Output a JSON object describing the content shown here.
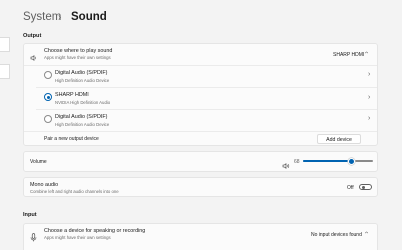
{
  "header": {
    "parent": "System",
    "current": "Sound"
  },
  "output": {
    "section_label": "Output",
    "choose": {
      "title": "Choose where to play sound",
      "subtitle": "Apps might have their own settings",
      "value": "SHARP HDMI"
    },
    "devices": [
      {
        "title": "Digital Audio (S/PDIF)",
        "subtitle": "High Definition Audio Device",
        "selected": false
      },
      {
        "title": "SHARP HDMI",
        "subtitle": "NVIDIA High Definition Audio",
        "selected": true
      },
      {
        "title": "Digital Audio (S/PDIF)",
        "subtitle": "High Definition Audio Device",
        "selected": false
      }
    ],
    "pair": {
      "label": "Pair a new output device",
      "button": "Add device"
    },
    "volume": {
      "label": "Volume",
      "value": "68",
      "level": 0.68
    },
    "mono": {
      "title": "Mono audio",
      "subtitle": "Combine left and right audio channels into one",
      "state": "Off"
    }
  },
  "input": {
    "section_label": "Input",
    "choose": {
      "title": "Choose a device for speaking or recording",
      "subtitle": "Apps might have their own settings",
      "value": "No input devices found"
    }
  },
  "icons": {
    "speaker": "speaker-icon",
    "mic": "microphone-icon",
    "chevron": "chevron-right-icon"
  },
  "colors": {
    "accent": "#0063b1",
    "background": "#f3f3f3",
    "card": "#fbfbfb"
  }
}
